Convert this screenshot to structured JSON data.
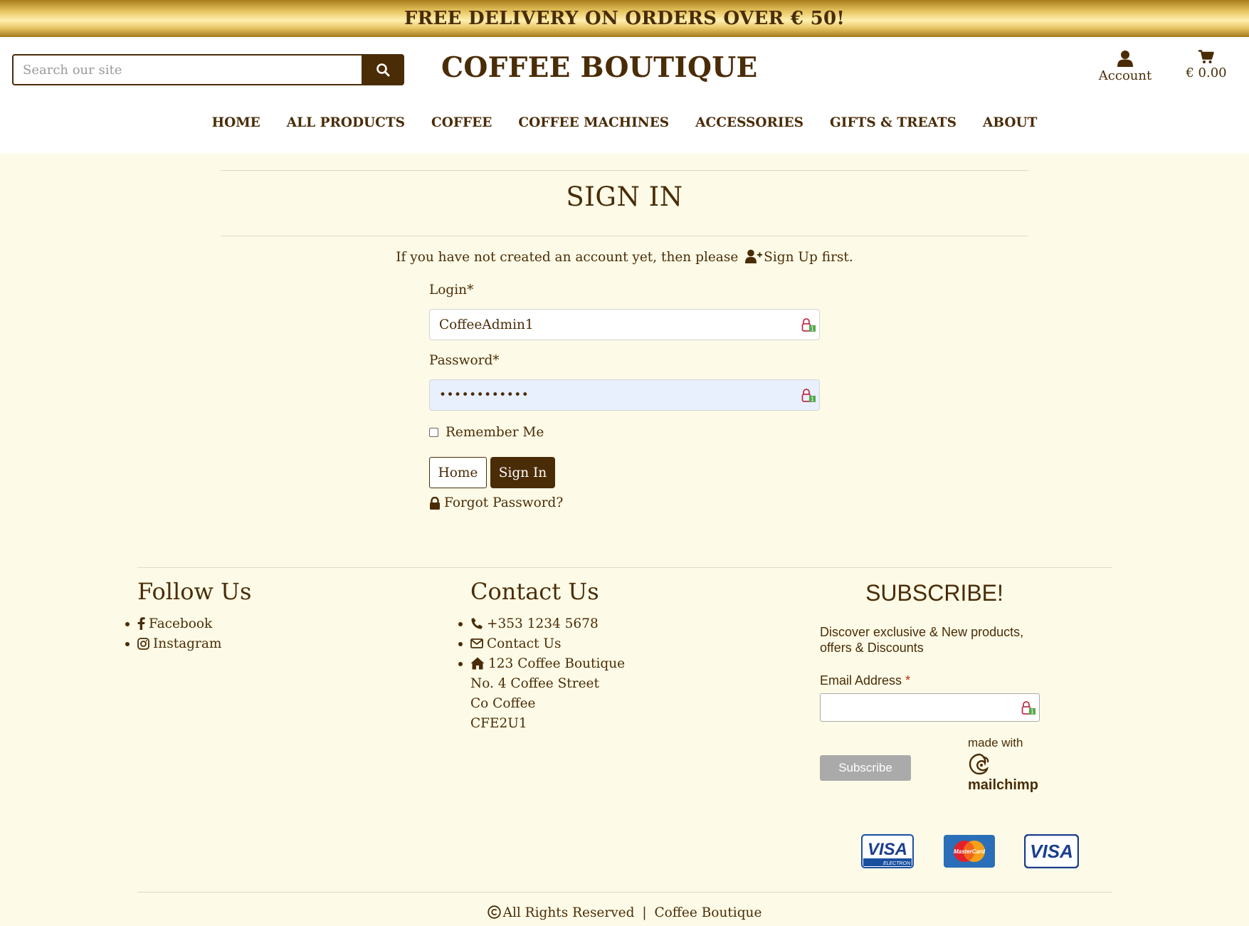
{
  "banner": {
    "text": "FREE DELIVERY ON ORDERS OVER € 50!"
  },
  "header": {
    "search_placeholder": "Search our site",
    "logo": "COFFEE BOUTIQUE",
    "account_label": "Account",
    "cart_total": "€ 0.00"
  },
  "nav": {
    "items": [
      "HOME",
      "ALL PRODUCTS",
      "COFFEE",
      "COFFEE MACHINES",
      "ACCESSORIES",
      "GIFTS & TREATS",
      "ABOUT"
    ]
  },
  "signin": {
    "title": "SIGN IN",
    "intro_prefix": "If you have not created an account yet, then please",
    "signup_link": "Sign Up",
    "intro_suffix": "first.",
    "login_label": "Login*",
    "login_value": "CoffeeAdmin1",
    "password_label": "Password*",
    "password_value": "••••••••••••",
    "remember_label": "Remember Me",
    "home_button": "Home",
    "signin_button": "Sign In",
    "forgot_link": "Forgot Password?"
  },
  "footer": {
    "follow": {
      "title": "Follow Us",
      "items": [
        "Facebook",
        "Instagram"
      ]
    },
    "contact": {
      "title": "Contact Us",
      "phone": "+353 1234 5678",
      "contact_link": "Contact Us",
      "address": [
        "123 Coffee Boutique",
        "No. 4 Coffee Street",
        "Co Coffee",
        "CFE2U1"
      ]
    },
    "subscribe": {
      "title": "SUBSCRIBE!",
      "text": "Discover exclusive & New products, offers & Discounts",
      "email_label": "Email Address",
      "required_mark": "*",
      "button": "Subscribe",
      "made_with": "made with",
      "brand": "mailchimp"
    },
    "payment_cards": [
      "VISA",
      "MasterCard",
      "VISA"
    ],
    "payment_card_sublabel": "ELECTRON",
    "copyright": "All Rights Reserved",
    "copyright_separator": "|",
    "copyright_brand": "Coffee Boutique"
  },
  "colors": {
    "brand": "#4a2c07",
    "background": "#fdfbe7",
    "autofill": "#e8f0fe",
    "required": "#c02b0a"
  },
  "icons": [
    "search-icon",
    "user-icon",
    "cart-icon",
    "user-plus-icon",
    "lock-icon",
    "facebook-icon",
    "instagram-icon",
    "phone-icon",
    "envelope-icon",
    "home-icon",
    "copyright-icon",
    "password-manager-icon",
    "mailchimp-logo"
  ]
}
